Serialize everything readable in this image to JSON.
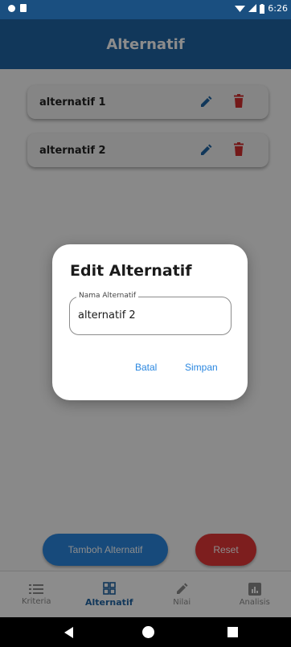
{
  "status_bar": {
    "time": "6:26"
  },
  "app_bar": {
    "title": "Alternatif"
  },
  "alternatives": [
    {
      "label": "alternatif 1"
    },
    {
      "label": "alternatif 2"
    }
  ],
  "actions": {
    "add_label": "Tamboh Alternatif",
    "reset_label": "Reset"
  },
  "bottom_nav": {
    "items": [
      {
        "label": "Kriteria",
        "icon": "list-icon"
      },
      {
        "label": "Alternatif",
        "icon": "grid-icon",
        "active": true
      },
      {
        "label": "Nilai",
        "icon": "pencil-icon"
      },
      {
        "label": "Analisis",
        "icon": "chart-icon"
      }
    ]
  },
  "dialog": {
    "title": "Edit Alternatif",
    "field_label": "Nama Alternatif",
    "field_value": "alternatif 2",
    "cancel_label": "Batal",
    "save_label": "Simpan"
  },
  "colors": {
    "primary": "#1f64a4",
    "accent": "#2a87e0",
    "danger": "#e33838"
  }
}
